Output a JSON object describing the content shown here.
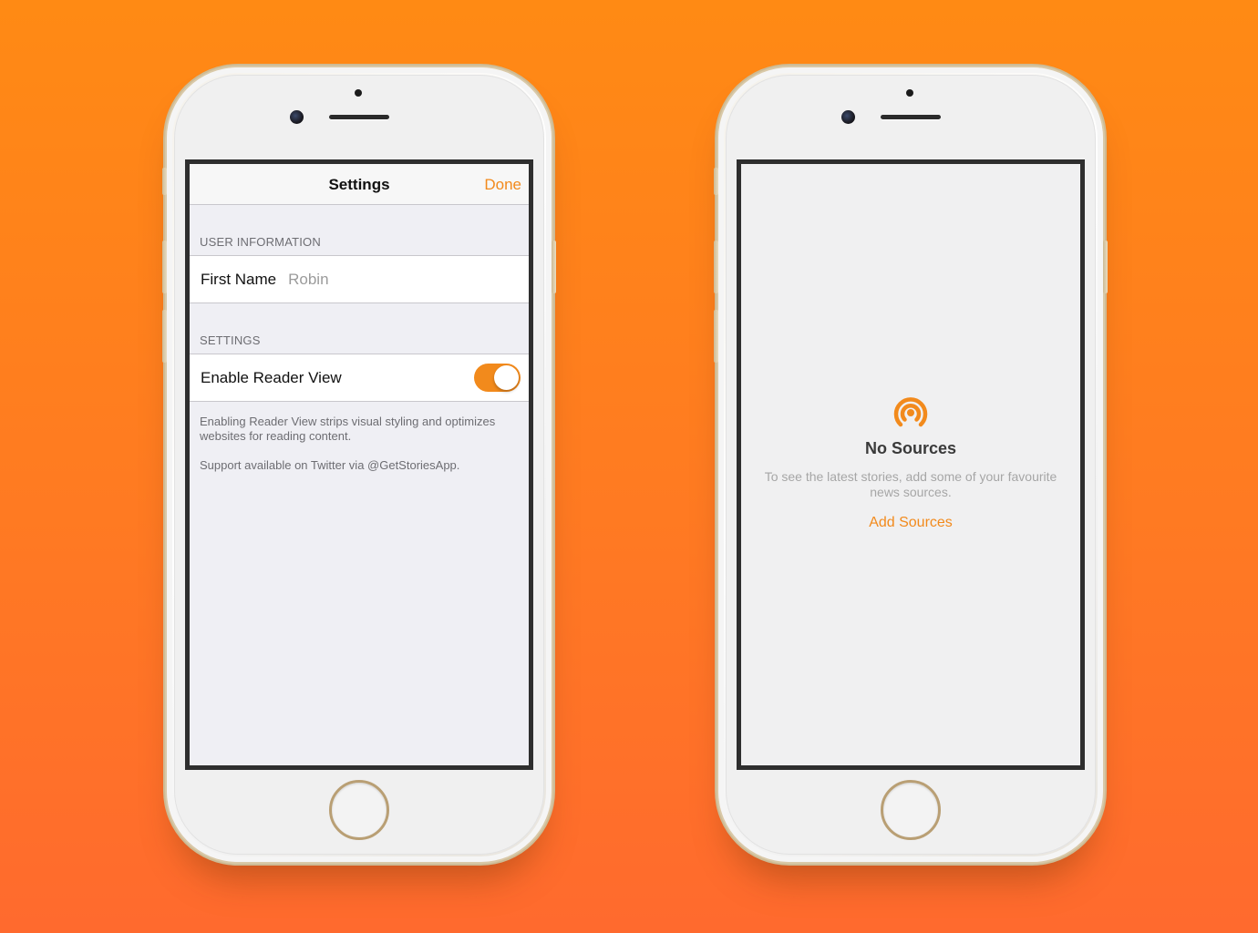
{
  "colors": {
    "accent": "#F28A1C",
    "background_top": "#FF8A14",
    "background_bottom": "#FF6A2E"
  },
  "settings_screen": {
    "nav": {
      "title": "Settings",
      "done_label": "Done"
    },
    "user_information": {
      "header": "USER INFORMATION",
      "first_name_label": "First Name",
      "first_name_value": "Robin"
    },
    "settings_section": {
      "header": "SETTINGS",
      "reader_view_label": "Enable Reader View",
      "reader_view_enabled": true
    },
    "footer": {
      "description": "Enabling Reader View strips visual styling and optimizes websites for reading content.",
      "support": "Support available on Twitter via @GetStoriesApp."
    }
  },
  "sources_screen": {
    "icon": "broadcast-icon",
    "title": "No Sources",
    "description": "To see the latest stories, add some of your favourite news sources.",
    "action_label": "Add Sources"
  }
}
